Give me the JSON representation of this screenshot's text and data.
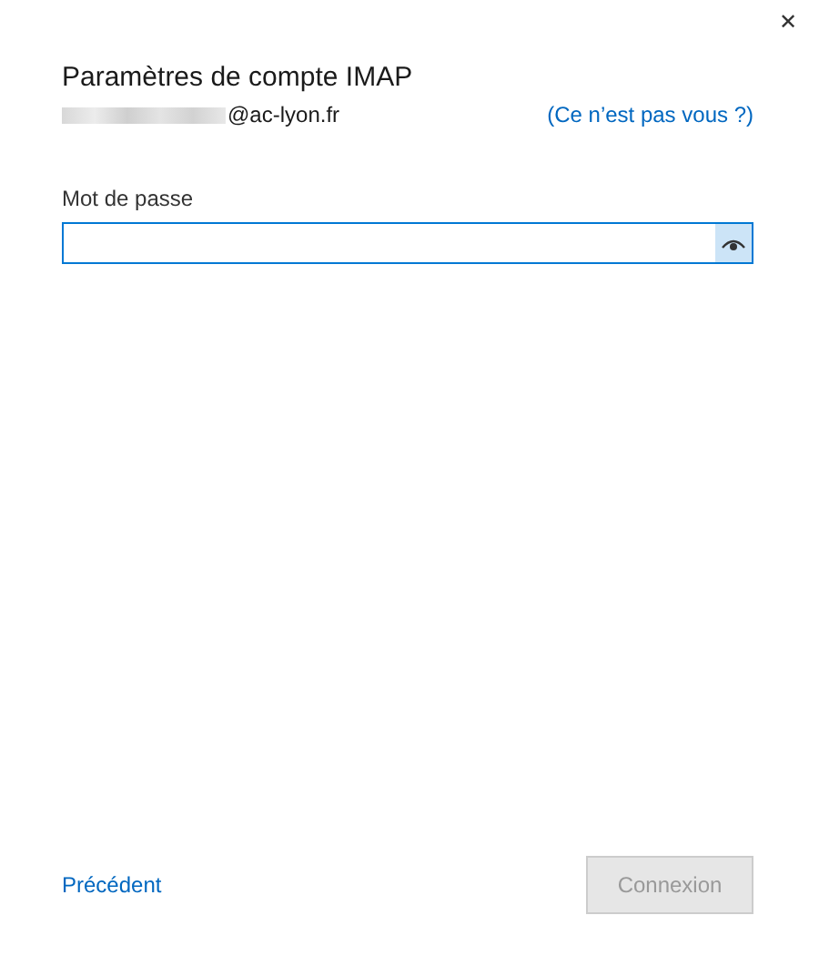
{
  "window": {
    "close": "✕"
  },
  "title": "Paramètres de compte IMAP",
  "account": {
    "email": "@ac-lyon.fr",
    "redacted": true,
    "switch_link": "(Ce n’est pas vous ?)"
  },
  "password": {
    "label": "Mot de passe"
  },
  "footer": {
    "back_link": "Précédent",
    "button": {
      "label": "Connexion",
      "disabled": true
    }
  }
}
